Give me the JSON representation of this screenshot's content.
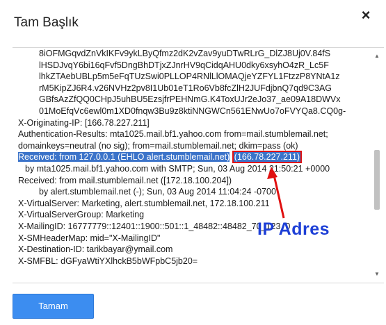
{
  "dialog": {
    "title": "Tam Başlık",
    "close_glyph": "×",
    "ok_label": "Tamam"
  },
  "headers": {
    "lines": [
      "8iOFMGqvdZnVkIKFv9ykLByQfmz2dK2vZav9yuDTwRLrG_DlZJ8Uj0V.84fS",
      "lHSDJvqY6bi16qFvf5DngBhDTjxZJnrHV9qCidqAHU0dky6xsyhO4zR_Lc5F",
      "lhkZTAebUBLp5m5eFqTUzSwi0PLLOP4RNlLlOMAQjeYZFYL1FtzzP8YNtA1z",
      "rM5KipZJ6R4.v26NVHz2pv8I1Ub01eT1Ro6Vb8fcZlH2JUFdjbnQ7qd9C3AG",
      "GBfsAzZfQQ0CHpJ5uhBU5EzsjfrPEHNmG.K4ToxUJr2eJo37_ae09A18DWVx",
      "01MoEfqVc6ewl0m1XD0fnqw3Bu9z8ktiNNGWCn561ENwUo7oFVYQa8.CQ0g-",
      "X-Originating-IP: [166.78.227.211]",
      "Authentication-Results: mta1025.mail.bf1.yahoo.com  from=mail.stumblemail.net;",
      "domainkeys=neutral (no sig);  from=mail.stumblemail.net; dkim=pass (ok)"
    ],
    "received_highlight": "Received: from 127.0.0.1  (EHLO alert.stumblemail.net)",
    "received_ip": "(166.78.227.211)",
    "lines2": [
      "by mta1025.mail.bf1.yahoo.com with SMTP; Sun, 03 Aug 2014 21:50:21 +0000",
      "Received: from mail.stumblemail.net ([172.18.100.204])",
      "by alert.stumblemail.net (-); Sun, 03 Aug 2014 11:04:24 -0700",
      "X-VirtualServer: Marketing, alert.stumblemail.net, 172.18.100.211",
      "X-VirtualServerGroup: Marketing",
      "X-MailingID: 16777779::12401::1900::501::1_48482::48482_70_123_0",
      "X-SMHeaderMap: mid=\"X-MailingID\"",
      "X-Destination-ID: tarikbayar@ymail.com",
      "X-SMFBL: dGFyaWtiYXlhckB5bWFpbC5jb20="
    ]
  },
  "annotation": {
    "label": "IP Adres",
    "color": "#1d3fd6",
    "box_color": "#e01010"
  },
  "icons": {
    "close": "close-icon",
    "scroll_up": "chevron-up-icon",
    "scroll_down": "chevron-down-icon"
  },
  "colors": {
    "highlight": "#3b73c9",
    "button": "#3c8df0"
  }
}
